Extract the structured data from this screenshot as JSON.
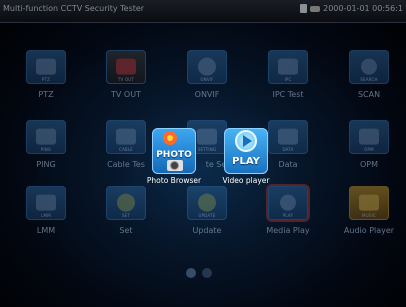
{
  "topbar": {
    "title": "Multi-function CCTV Security Tester",
    "datetime": "2000-01-01 00:56:1"
  },
  "menu": {
    "items": [
      {
        "label": "PTZ",
        "tile_text": "PTZ"
      },
      {
        "label": "TV OUT",
        "tile_text": "TV OUT"
      },
      {
        "label": "ONVIF",
        "tile_text": "ONVIF"
      },
      {
        "label": "IPC Test",
        "tile_text": "IPC"
      },
      {
        "label": "SCAN",
        "tile_text": "SEARCH"
      },
      {
        "label": "PING",
        "tile_text": "PING"
      },
      {
        "label": "Cable Tes",
        "tile_text": "CABLE"
      },
      {
        "label": "te Se",
        "tile_text": "SETTING"
      },
      {
        "label": "Data",
        "tile_text": "DATA"
      },
      {
        "label": "OPM",
        "tile_text": "OPM"
      },
      {
        "label": "LMM",
        "tile_text": "LMM"
      },
      {
        "label": "Set",
        "tile_text": "SET"
      },
      {
        "label": "Update",
        "tile_text": "UPDATE"
      },
      {
        "label": "Media Play",
        "tile_text": "PLAY"
      },
      {
        "label": "Audio Player",
        "tile_text": "MUSIC"
      }
    ]
  },
  "popup": {
    "photo_title": "PHOTO",
    "photo_label": "Photo Browser",
    "video_title": "PLAY",
    "video_label": "Video player"
  },
  "pager": {
    "pages": 2,
    "current": 1
  }
}
